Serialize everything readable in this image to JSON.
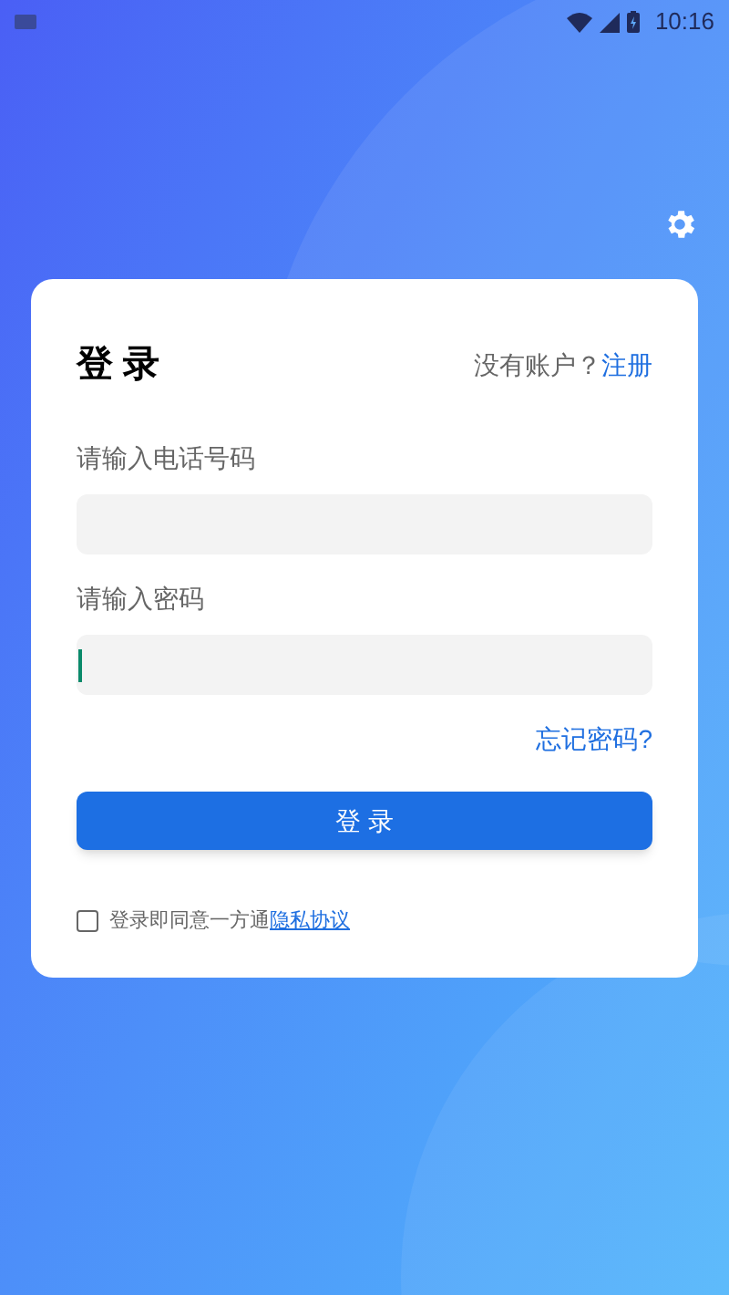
{
  "status_bar": {
    "time": "10:16"
  },
  "card": {
    "title": "登 录",
    "signup_prompt": "没有账户？",
    "signup_link": "注册",
    "fields": [
      {
        "label": "请输入电话号码",
        "focused": false
      },
      {
        "label": "请输入密码",
        "focused": true
      }
    ],
    "forgot_password": "忘记密码?",
    "login_button": "登 录",
    "agreement": {
      "checked": false,
      "text": "登录即同意一方通",
      "link": "隐私协议"
    }
  }
}
